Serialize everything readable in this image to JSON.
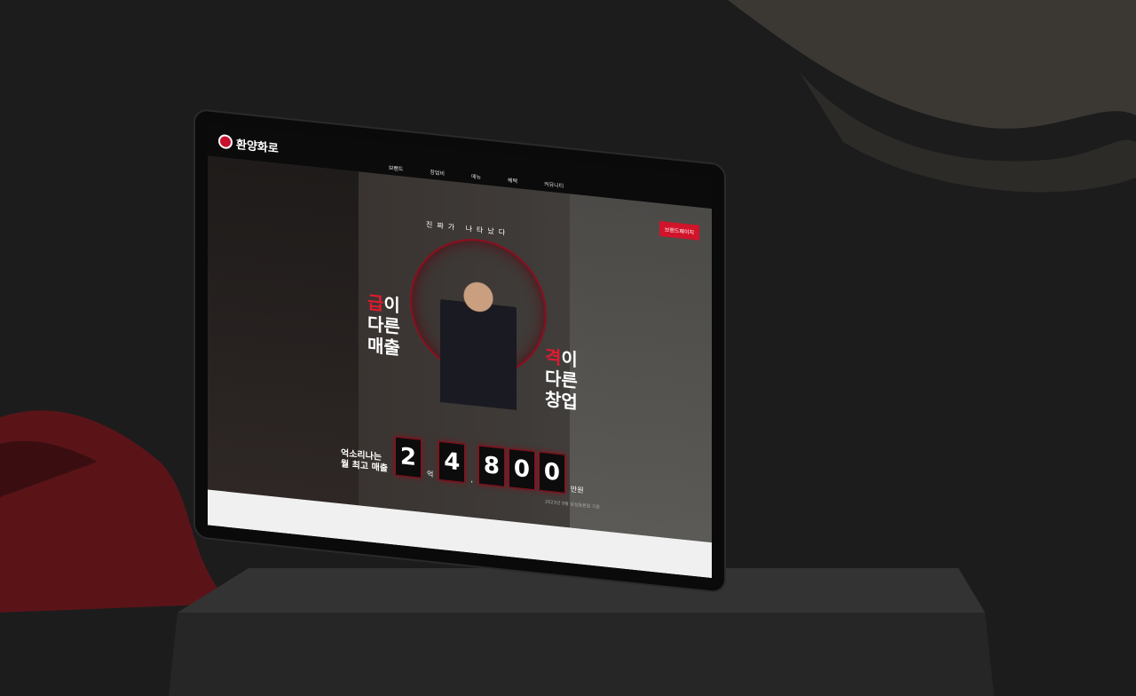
{
  "brand": {
    "logo_text": "환양화로"
  },
  "nav": {
    "items": [
      {
        "label": "브랜드"
      },
      {
        "label": "창업비"
      },
      {
        "label": "메뉴"
      },
      {
        "label": "혜택"
      },
      {
        "label": "커뮤니티"
      }
    ],
    "cta": "브랜드페이지"
  },
  "hero": {
    "tagline": "진짜가 나타났다",
    "left_lines": [
      "급이",
      "다른",
      "매출"
    ],
    "right_lines": [
      "격이",
      "다른",
      "창업"
    ],
    "counter_label_1": "억소리나는",
    "counter_label_2": "월 최고 매출",
    "digits": [
      "2",
      "4",
      "8",
      "0",
      "0"
    ],
    "unit_eok": "억",
    "separator": ",",
    "unit_manwon": "만원",
    "caption": "2023년 9월 성성동본점 기준"
  },
  "colors": {
    "accent": "#e01a2f",
    "dark": "#0b0b0b"
  }
}
